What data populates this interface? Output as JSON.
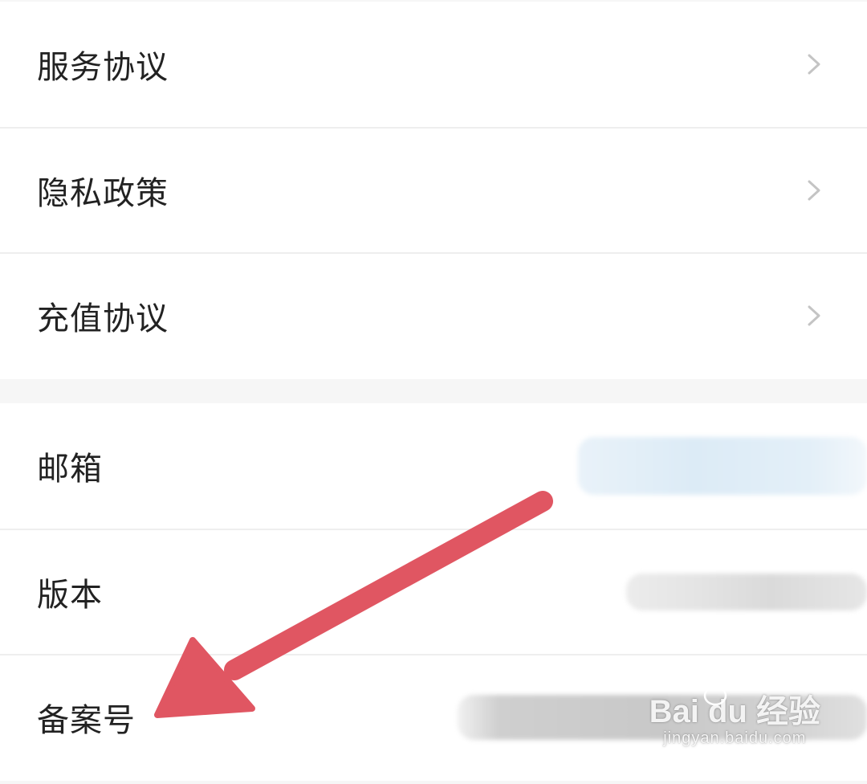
{
  "settings": {
    "group1": [
      {
        "label": "服务协议"
      },
      {
        "label": "隐私政策"
      },
      {
        "label": "充值协议"
      }
    ],
    "group2": [
      {
        "label": "邮箱"
      },
      {
        "label": "版本"
      },
      {
        "label": "备案号"
      }
    ]
  },
  "icons": {
    "chevron": "chevron-right-icon",
    "annotation": "red-arrow-annotation"
  },
  "colors": {
    "annotation_arrow": "#e05662",
    "chevron": "#c4c4c4",
    "label_text": "#222222",
    "divider": "#eeeeee",
    "background": "#f6f6f6"
  },
  "watermark": {
    "brand": "Bai du 经验",
    "url": "jingyan.baidu.com"
  }
}
